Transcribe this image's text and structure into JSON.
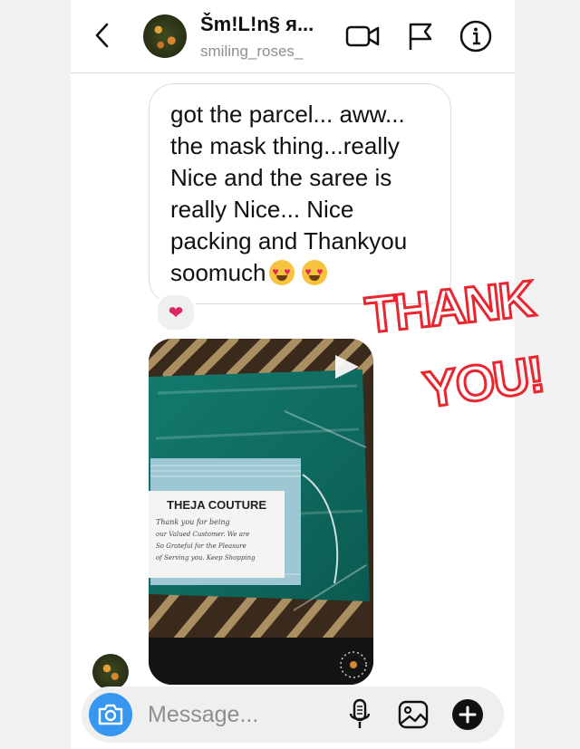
{
  "header": {
    "display_name": "Šm!L!n§ я...",
    "username": "smiling_roses_"
  },
  "message": {
    "lines": [
      "got the parcel... aww...",
      "the mask thing...really",
      "Nice and the saree is",
      "really Nice... Nice",
      "packing and Thankyou",
      "soomuch"
    ],
    "reaction": "❤"
  },
  "photo": {
    "brand": "THEJA COUTURE",
    "note_lines": [
      "Thank you for being",
      "our Valued Customer. We are",
      "So Grateful for the Pleasure",
      "of Serving you. Keep Shopping"
    ]
  },
  "sticker": {
    "line1": "THANK",
    "line2": "YOU!"
  },
  "composer": {
    "placeholder": "Message..."
  },
  "colors": {
    "accent": "#3797f0",
    "heart": "#e0245e",
    "sticker": "#e8262f"
  },
  "icons": [
    "back-chevron-icon",
    "video-camera-icon",
    "flag-icon",
    "info-icon",
    "camera-icon",
    "microphone-icon",
    "gallery-icon",
    "plus-icon",
    "play-icon"
  ]
}
